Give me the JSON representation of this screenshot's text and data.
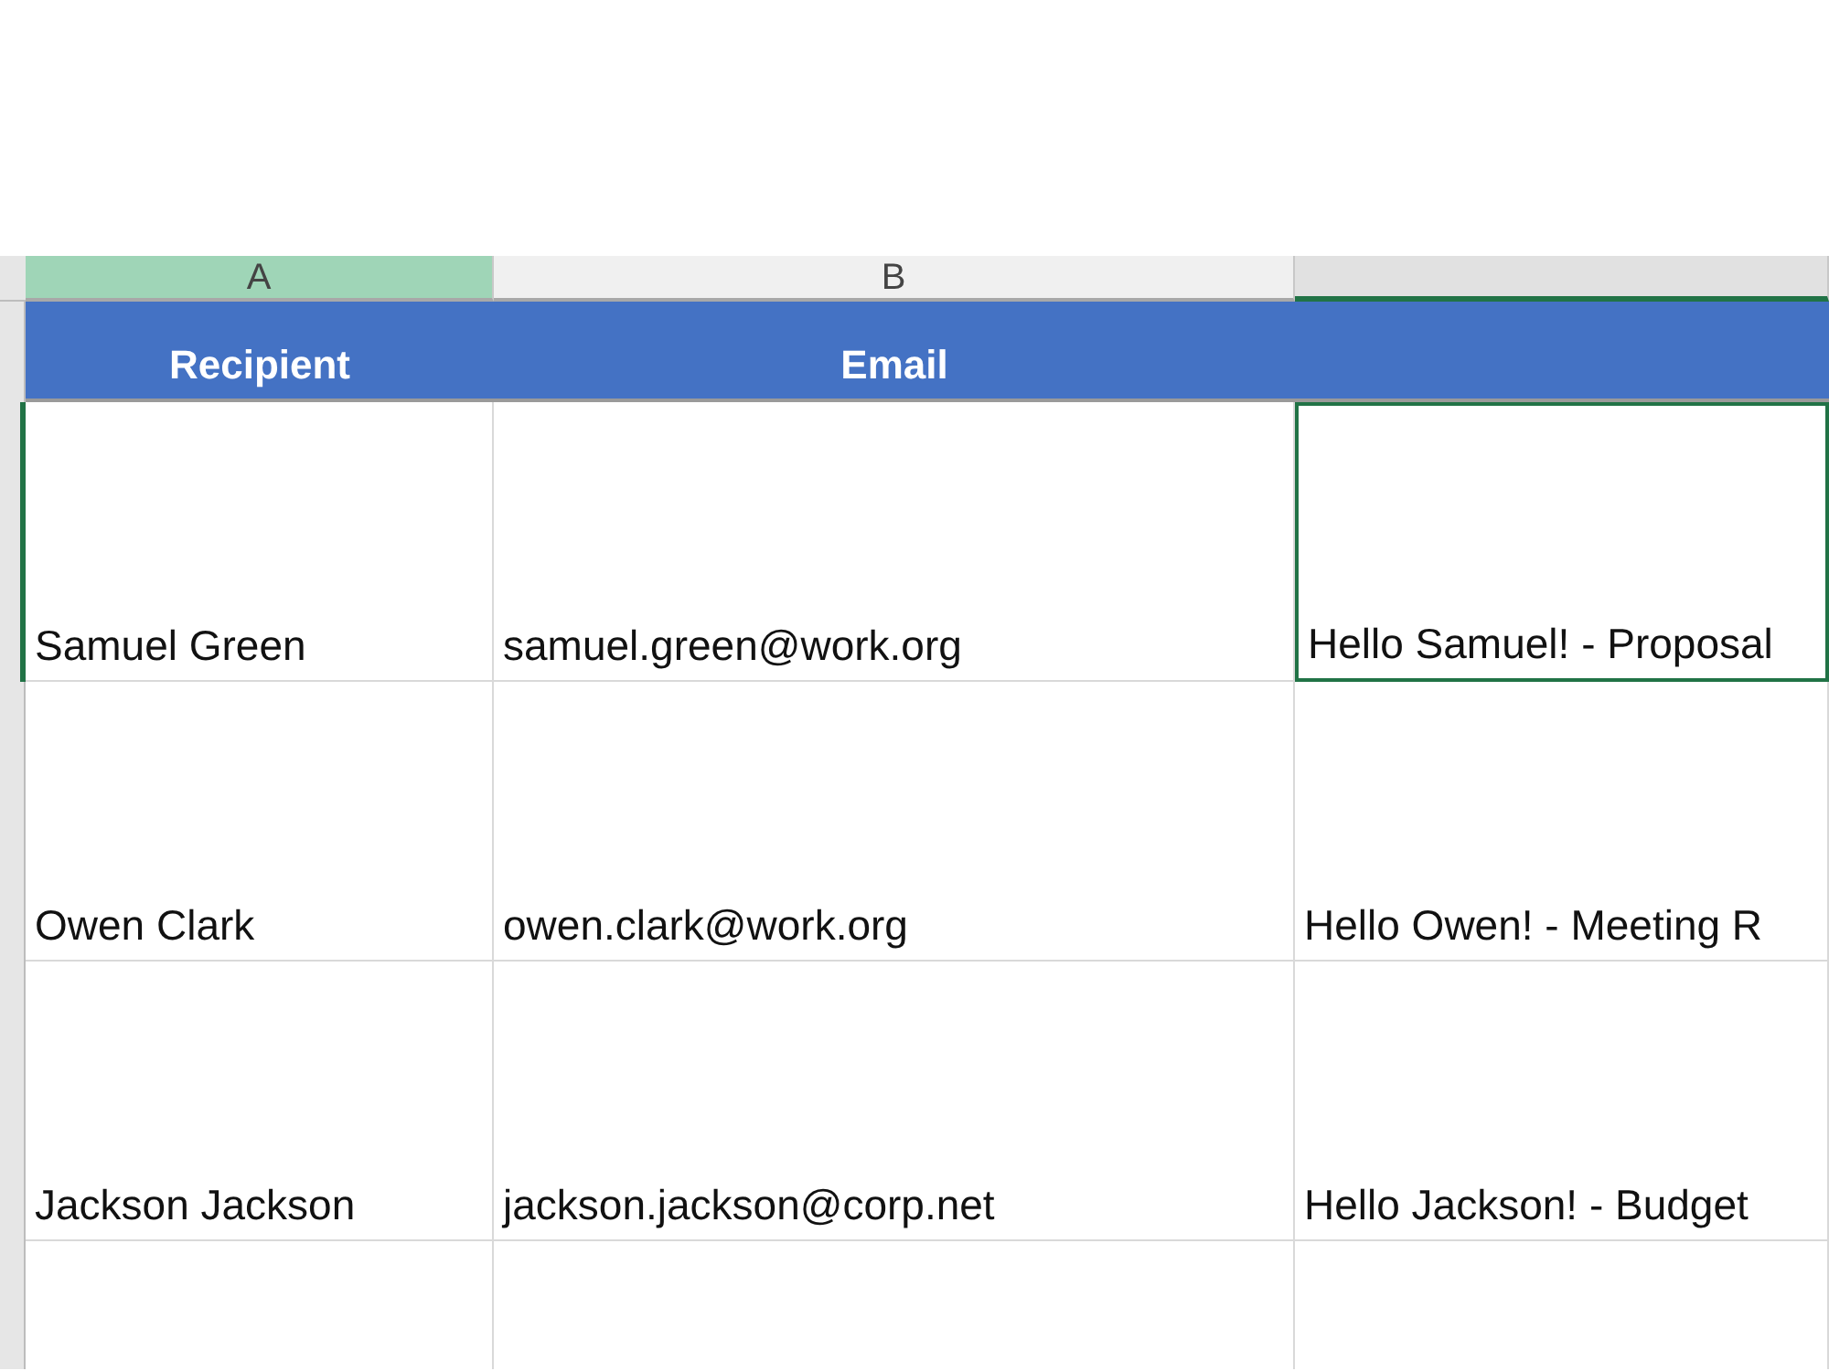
{
  "columns": [
    {
      "label": "A",
      "selected": true,
      "highlighted": false
    },
    {
      "label": "B",
      "selected": false,
      "highlighted": false
    },
    {
      "selected": false,
      "highlighted": true
    }
  ],
  "header_row": [
    "Recipient",
    "Email"
  ],
  "rows": [
    {
      "selected": true,
      "cells": [
        {
          "text": "Samuel Green",
          "active": false
        },
        {
          "text": "samuel.green@work.org",
          "active": false
        },
        {
          "text": "Hello Samuel! - Proposal",
          "active": true
        }
      ]
    },
    {
      "selected": false,
      "cells": [
        {
          "text": "Owen Clark",
          "active": false
        },
        {
          "text": "owen.clark@work.org",
          "active": false
        },
        {
          "text": "Hello Owen! - Meeting R",
          "active": false
        }
      ]
    },
    {
      "selected": false,
      "cells": [
        {
          "text": "Jackson Jackson",
          "active": false
        },
        {
          "text": "jackson.jackson@corp.net",
          "active": false
        },
        {
          "text": "Hello Jackson! - Budget",
          "active": false
        }
      ]
    }
  ]
}
